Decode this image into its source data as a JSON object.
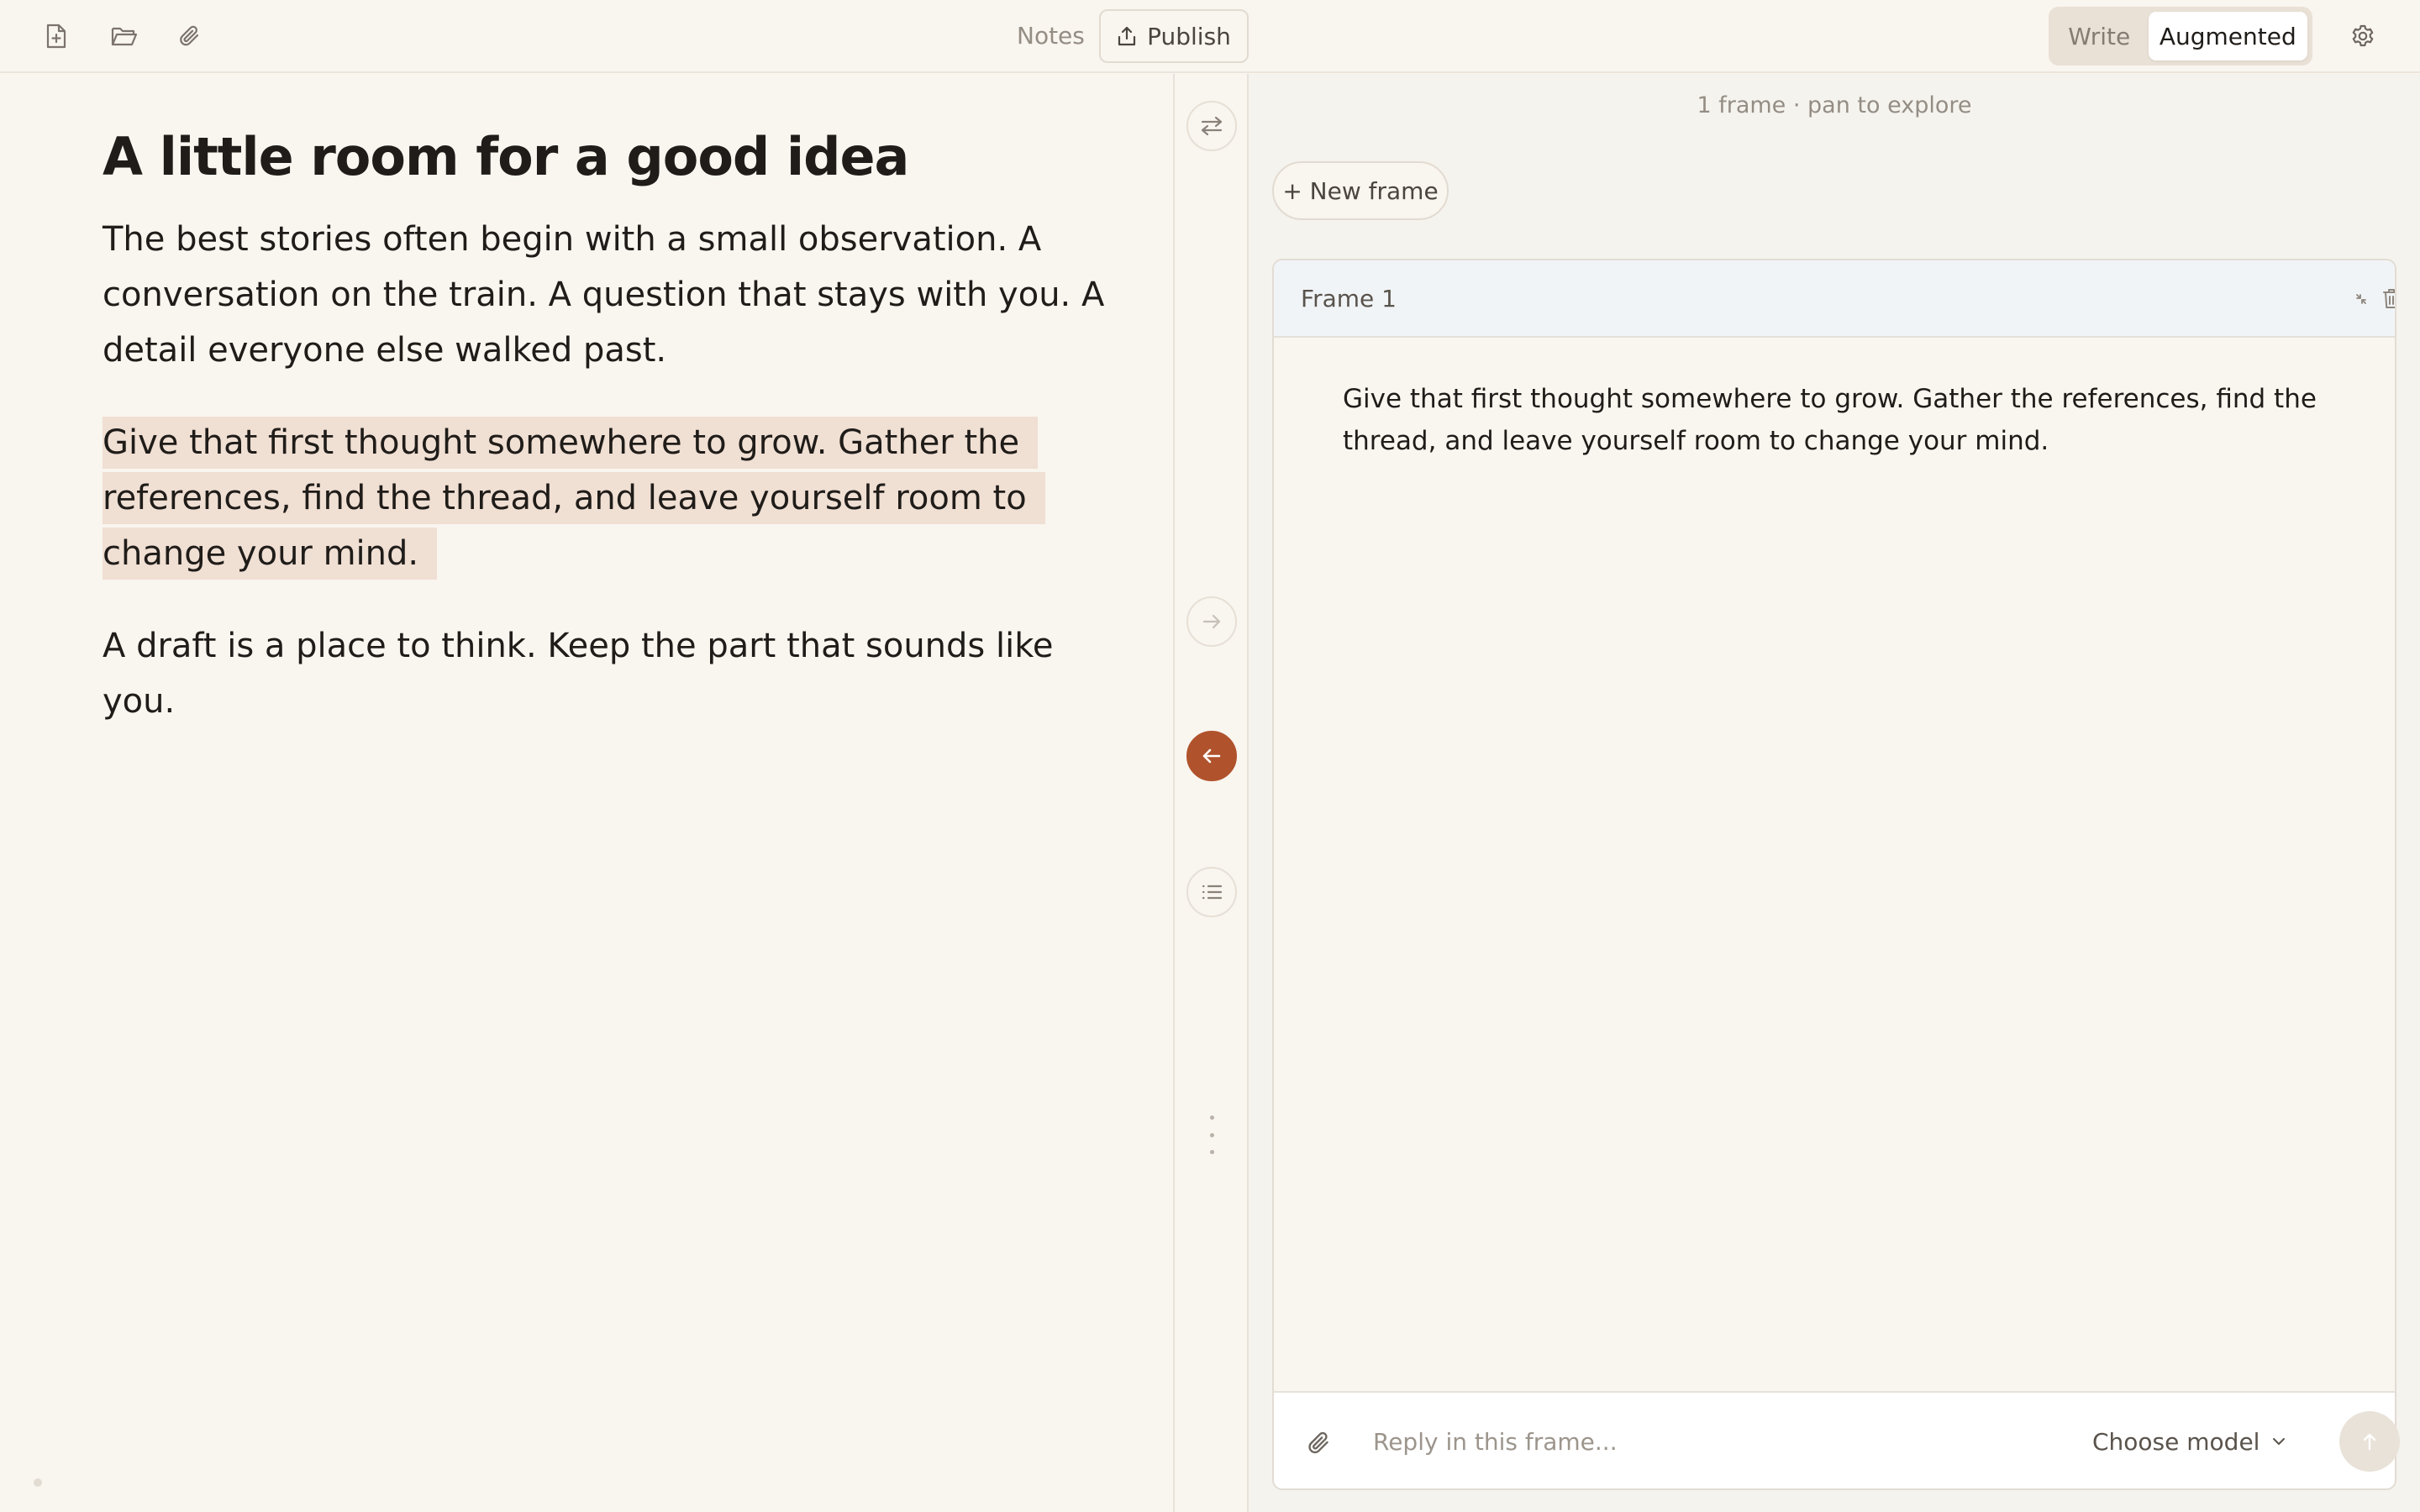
{
  "toolbar": {
    "icons": [
      "new-file-icon",
      "folder-open-icon",
      "paperclip-icon"
    ],
    "notes_label": "Notes",
    "publish_label": "Publish",
    "mode": {
      "write_label": "Write",
      "augmented_label": "Augmented",
      "active": "Augmented"
    },
    "settings_icon": "gear-icon"
  },
  "editor": {
    "title": "A little room for a good idea",
    "paragraphs": [
      "The best stories often begin with a small observation. A conversation on the train. A question that stays with you. A detail everyone else walked past.",
      "Give that first thought somewhere to grow. Gather the references, find the thread, and leave yourself room to change your mind.",
      "A draft is a place to think. Keep the part that sounds like you."
    ],
    "highlighted_paragraph_index": 1
  },
  "gutter": {
    "icons": [
      "swap-icon",
      "arrow-right-icon",
      "arrow-left-icon",
      "list-icon",
      "more-vertical-icon"
    ]
  },
  "panel": {
    "frames_info": "1 frame · pan to explore",
    "new_frame_label": "+ New frame",
    "frame": {
      "title": "Frame 1",
      "body": "Give that first thought somewhere to grow. Gather the references, find the thread, and leave yourself room to change your mind."
    },
    "reply": {
      "placeholder": "Reply in this frame...",
      "model_label": "Choose model"
    }
  },
  "colors": {
    "background": "#f9f5ef",
    "accent": "#b0522c",
    "highlight": "#f0dfd3",
    "frame_header": "#f1f4f7"
  }
}
